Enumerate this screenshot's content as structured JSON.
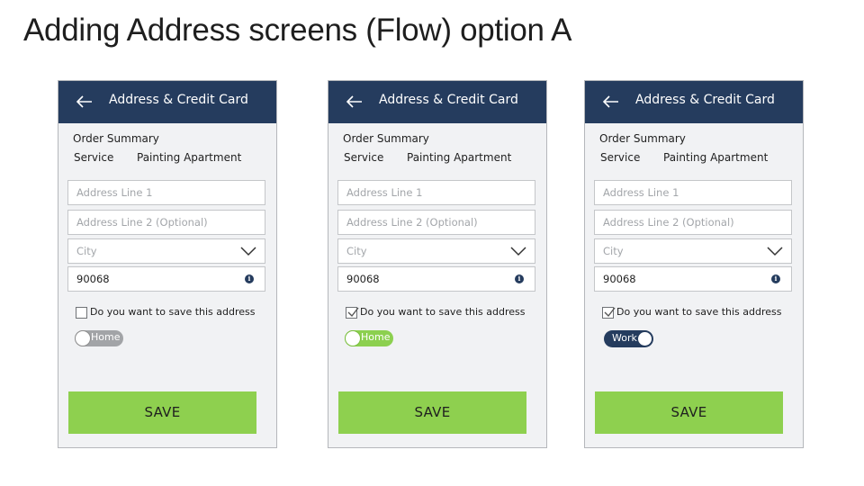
{
  "slide": {
    "title": "Adding Address screens (Flow) option A"
  },
  "colors": {
    "appbar": "#253c5e",
    "save": "#8ed04f",
    "screen_bg": "#f1f2f4"
  },
  "screens": [
    {
      "appbar_title": "Address & Credit Card",
      "order_summary": "Order Summary",
      "service_label": "Service",
      "service_value": "Painting Apartment",
      "address1_placeholder": "Address Line 1",
      "address2_placeholder": "Address Line 2 (Optional)",
      "city_placeholder": "City",
      "zip_value": "90068",
      "save_checkbox_label": "Do you want to save this address",
      "save_checked": false,
      "address_type": "Home",
      "save_label": "SAVE"
    },
    {
      "appbar_title": "Address & Credit Card",
      "order_summary": "Order Summary",
      "service_label": "Service",
      "service_value": "Painting Apartment",
      "address1_placeholder": "Address Line 1",
      "address2_placeholder": "Address Line 2 (Optional)",
      "city_placeholder": "City",
      "zip_value": "90068",
      "save_checkbox_label": "Do you want to save this address",
      "save_checked": true,
      "address_type": "Home",
      "save_label": "SAVE"
    },
    {
      "appbar_title": "Address & Credit Card",
      "order_summary": "Order Summary",
      "service_label": "Service",
      "service_value": "Painting Apartment",
      "address1_placeholder": "Address Line 1",
      "address2_placeholder": "Address Line 2 (Optional)",
      "city_placeholder": "City",
      "zip_value": "90068",
      "save_checkbox_label": "Do you want to save this address",
      "save_checked": true,
      "address_type": "Work",
      "save_label": "SAVE"
    }
  ]
}
